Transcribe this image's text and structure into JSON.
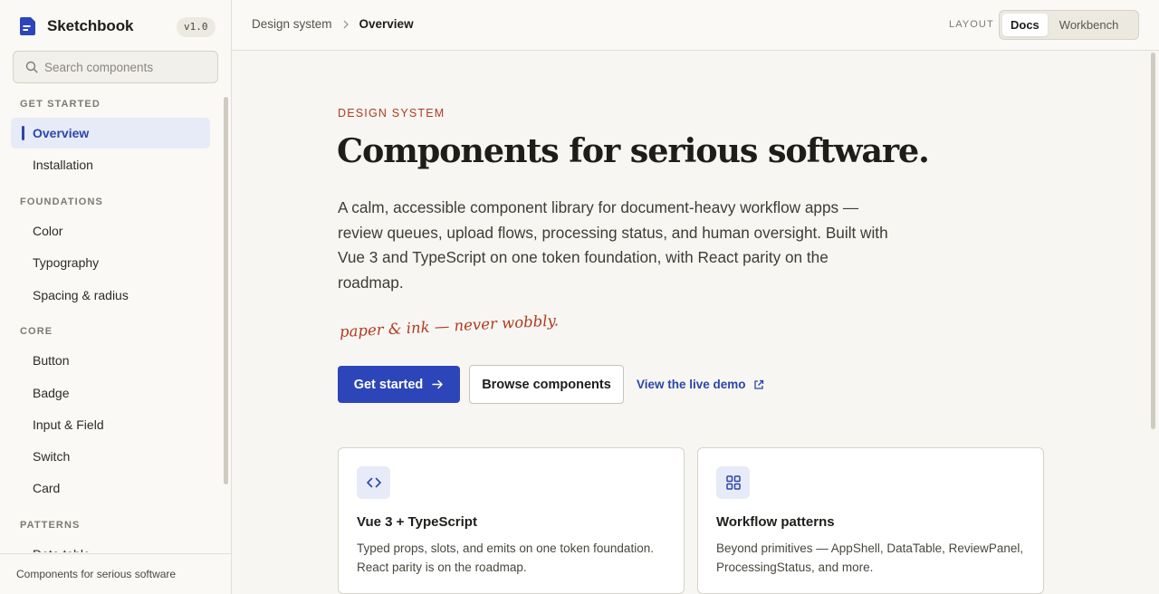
{
  "brand": {
    "name": "Sketchbook",
    "version": "v1.0"
  },
  "search": {
    "placeholder": "Search components"
  },
  "sidebar": {
    "sections": [
      {
        "label": "GET STARTED",
        "items": [
          "Overview",
          "Installation"
        ]
      },
      {
        "label": "FOUNDATIONS",
        "items": [
          "Color",
          "Typography",
          "Spacing & radius"
        ]
      },
      {
        "label": "CORE",
        "items": [
          "Button",
          "Badge",
          "Input & Field",
          "Switch",
          "Card"
        ]
      },
      {
        "label": "PATTERNS",
        "items": [
          "Data table"
        ]
      }
    ],
    "active_item": "Overview",
    "footer": "Components for serious software"
  },
  "topbar": {
    "breadcrumb": [
      "Design system",
      "Overview"
    ],
    "layout_label": "LAYOUT",
    "layout_options": [
      "Docs",
      "Workbench"
    ],
    "layout_selected": "Docs"
  },
  "hero": {
    "eyebrow": "DESIGN SYSTEM",
    "title": "Components for serious software.",
    "lead": "A calm, accessible component library for document-heavy workflow apps — review queues, upload flows, processing status, and human oversight. Built with Vue 3 and TypeScript on one token foundation, with React parity on the roadmap.",
    "handnote": "paper & ink — never wobbly.",
    "primary_cta": "Get started",
    "secondary_cta": "Browse components",
    "demo_link": "View the live demo"
  },
  "cards": [
    {
      "icon": "code-icon",
      "title": "Vue 3 + TypeScript",
      "text": "Typed props, slots, and emits on one token foundation. React parity is on the roadmap."
    },
    {
      "icon": "grid-icon",
      "title": "Workflow patterns",
      "text": "Beyond primitives — AppShell, DataTable, ReviewPanel, ProcessingStatus, and more."
    }
  ],
  "colors": {
    "accent": "#2c45b8",
    "eyebrow": "#b23a1e",
    "background": "#f7f6f2"
  }
}
